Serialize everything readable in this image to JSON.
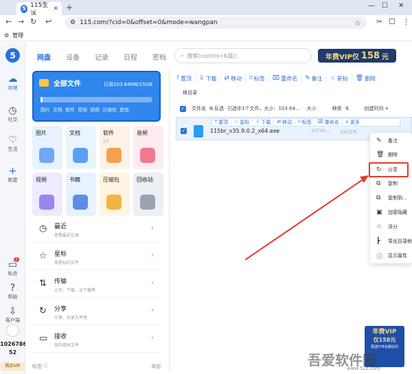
{
  "browser": {
    "tab_title": "115生活",
    "tab_logo": "5",
    "url": "115.com/?cid=0&offset=0&mode=wangpan",
    "bookmark": "管理"
  },
  "rail": {
    "logo": "5",
    "items": [
      {
        "label": "存储",
        "icon": "cloud-icon"
      },
      {
        "label": "社交",
        "icon": "clock-icon"
      },
      {
        "label": "生活",
        "icon": "heart-icon"
      },
      {
        "label": "新建",
        "icon": "plus-icon"
      },
      {
        "label": "私信",
        "icon": "chat-icon",
        "badge": "2"
      },
      {
        "label": "帮助",
        "icon": "help-icon"
      },
      {
        "label": "客户端",
        "icon": "download-icon"
      }
    ],
    "user_id_line1": "1026786",
    "user_id_line2": "52",
    "buy_vip": "购买VIP"
  },
  "main_tabs": [
    "网盘",
    "设备",
    "记录",
    "日程",
    "密档"
  ],
  "storage_card": {
    "title": "全部文件",
    "usage": "已用103.64MB/15GB",
    "usage_fraction": 0.007,
    "types": [
      "图片",
      "文档",
      "软件",
      "音频",
      "视频",
      "压缩包",
      "其他"
    ]
  },
  "categories": [
    {
      "label": "图片",
      "sub": "",
      "color": "#e8f2ff"
    },
    {
      "label": "文档",
      "sub": "",
      "color": "#e9f4ff"
    },
    {
      "label": "软件",
      "sub": "1个",
      "color": "#fff1e6"
    },
    {
      "label": "音频",
      "sub": "",
      "color": "#fdecef"
    },
    {
      "label": "视频",
      "sub": "",
      "color": "#efeaff"
    },
    {
      "label": "书籍",
      "sub": "",
      "color": "#e8f1ff"
    },
    {
      "label": "压缩包",
      "sub": "",
      "color": "#fff4e2"
    },
    {
      "label": "回收站",
      "sub": "",
      "color": "#eceff3"
    }
  ],
  "list_rows": [
    {
      "title": "最近",
      "desc": "查看最近记录"
    },
    {
      "title": "星标",
      "desc": "我星标的文件"
    },
    {
      "title": "传输",
      "desc": "上传、下载、云下载等"
    },
    {
      "title": "分享",
      "desc": "分享、共享文件等"
    },
    {
      "title": "接收",
      "desc": "我的接收文件"
    }
  ],
  "label_area": {
    "label": "标签",
    "add": "添加"
  },
  "search": {
    "placeholder": "搜索(control+K或/)"
  },
  "vip_banner": {
    "prefix": "年费VIP仅",
    "price": "158",
    "suffix": "元"
  },
  "toolbar": [
    "置顶",
    "下载",
    "移动",
    "标签",
    "重命名",
    "备注",
    "星标",
    "删除"
  ],
  "breadcrumb": "根目录",
  "header": {
    "filename": "文件名",
    "invert": "反选",
    "selected": "已选中1个文件，大小：103.64...",
    "size": "大小",
    "type": "种类",
    "created": "创建时间"
  },
  "row_toolbar": [
    "置顶",
    "星标",
    "下载",
    "移动",
    "标签",
    "重命名",
    "更多"
  ],
  "file": {
    "name": "115br_v35.9.0.2_x64.exe",
    "size": "103.64...",
    "type": "EXE文件"
  },
  "context_menu": [
    {
      "label": "备注",
      "icon": "note-icon"
    },
    {
      "label": "删除",
      "icon": "trash-icon"
    },
    {
      "label": "分享",
      "icon": "share-icon"
    },
    {
      "label": "复制",
      "icon": "copy-icon"
    },
    {
      "label": "复制到...",
      "icon": "copy-to-icon"
    },
    {
      "label": "加密隐藏",
      "icon": "lock-icon"
    },
    {
      "label": "评分",
      "icon": "star-rate-icon"
    },
    {
      "label": "导出目录树",
      "icon": "tree-icon"
    },
    {
      "label": "显示属性",
      "icon": "info-icon"
    }
  ],
  "ad": {
    "line1": "年费VIP",
    "line2": "仅158元",
    "line3": "再送5TB长期空间"
  },
  "watermark": {
    "main": "吾爱软件园",
    "site": "www.52z.com"
  }
}
